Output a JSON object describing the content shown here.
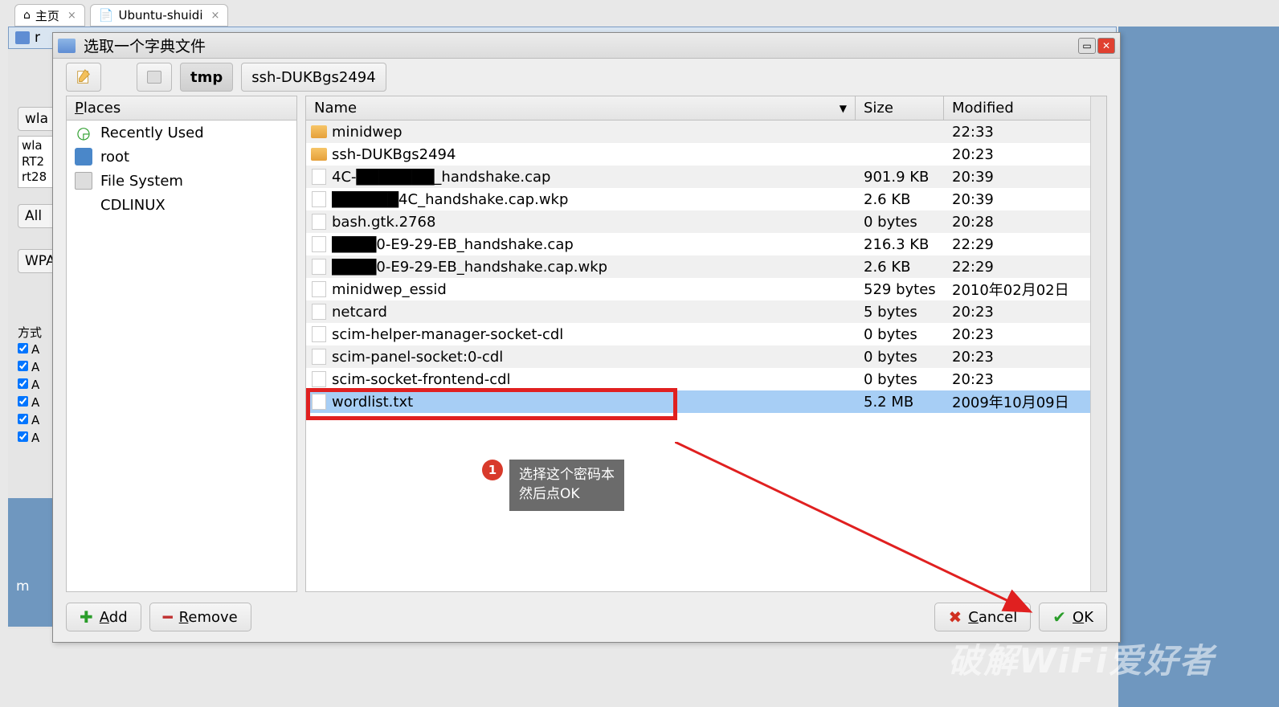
{
  "browserTabs": [
    {
      "label": "主页",
      "icon": "home"
    },
    {
      "label": "Ubuntu-shuidi",
      "icon": "doc"
    }
  ],
  "bg": {
    "wlan_btn": "wla",
    "wlan_list": "wla\nRT2\nrt28",
    "all_btn": "All",
    "wpa_btn": "WPA",
    "method_label": "方式",
    "chk": [
      "A",
      "A",
      "A",
      "A",
      "A",
      "A"
    ],
    "bottom_m": "m"
  },
  "dialog": {
    "title": "选取一个字典文件",
    "path": {
      "seg1": "tmp",
      "seg2": "ssh-DUKBgs2494"
    },
    "places": {
      "header": "Places",
      "items": [
        {
          "label": "Recently Used",
          "icon": "recent"
        },
        {
          "label": "root",
          "icon": "root"
        },
        {
          "label": "File System",
          "icon": "drive"
        },
        {
          "label": "CDLINUX",
          "icon": "none"
        }
      ]
    },
    "columns": {
      "name": "Name",
      "size": "Size",
      "modified": "Modified"
    },
    "files": [
      {
        "name": "minidwep",
        "size": "",
        "modified": "22:33",
        "type": "folder"
      },
      {
        "name": "ssh-DUKBgs2494",
        "size": "",
        "modified": "20:23",
        "type": "folder"
      },
      {
        "name": "4C-███████_handshake.cap",
        "size": "901.9 KB",
        "modified": "20:39",
        "type": "file"
      },
      {
        "name": "██████4C_handshake.cap.wkp",
        "size": "2.6 KB",
        "modified": "20:39",
        "type": "file"
      },
      {
        "name": "bash.gtk.2768",
        "size": "0 bytes",
        "modified": "20:28",
        "type": "file"
      },
      {
        "name": "████0-E9-29-EB_handshake.cap",
        "size": "216.3 KB",
        "modified": "22:29",
        "type": "file"
      },
      {
        "name": "████0-E9-29-EB_handshake.cap.wkp",
        "size": "2.6 KB",
        "modified": "22:29",
        "type": "file"
      },
      {
        "name": "minidwep_essid",
        "size": "529 bytes",
        "modified": "2010年02月02日",
        "type": "file"
      },
      {
        "name": "netcard",
        "size": "5 bytes",
        "modified": "20:23",
        "type": "file"
      },
      {
        "name": "scim-helper-manager-socket-cdl",
        "size": "0 bytes",
        "modified": "20:23",
        "type": "file"
      },
      {
        "name": "scim-panel-socket:0-cdl",
        "size": "0 bytes",
        "modified": "20:23",
        "type": "file"
      },
      {
        "name": "scim-socket-frontend-cdl",
        "size": "0 bytes",
        "modified": "20:23",
        "type": "file"
      },
      {
        "name": "wordlist.txt",
        "size": "5.2 MB",
        "modified": "2009年10月09日",
        "type": "file",
        "selected": true
      }
    ],
    "buttons": {
      "add": "Add",
      "remove": "Remove",
      "cancel": "Cancel",
      "ok": "OK"
    }
  },
  "callout": {
    "number": "1",
    "line1": "选择这个密码本",
    "line2": "然后点OK"
  },
  "watermark": "破解WiFi爱好者"
}
